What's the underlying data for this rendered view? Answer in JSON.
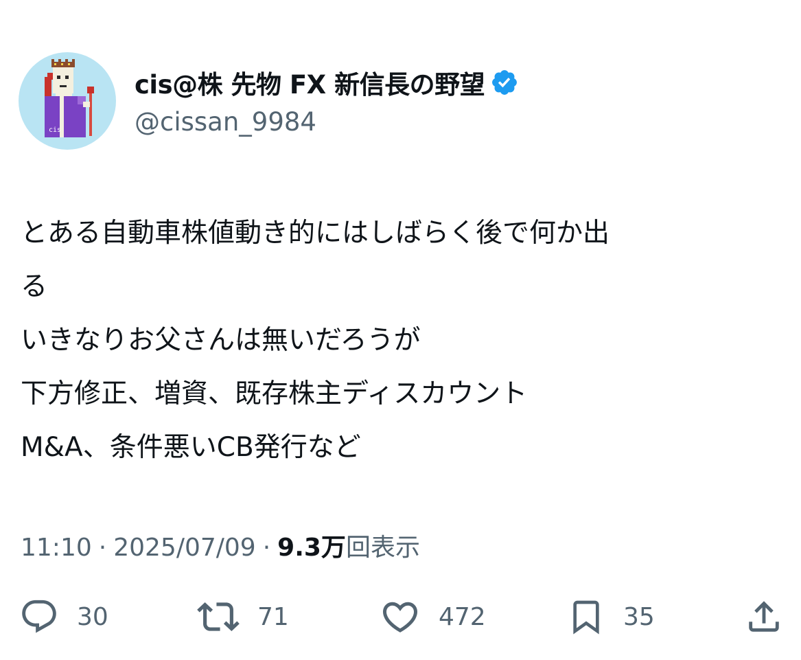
{
  "user": {
    "display_name": "cis@株 先物 FX 新信長の野望",
    "handle": "@cissan_9984",
    "verified": true,
    "avatar_label": "cis"
  },
  "tweet": {
    "lines": [
      "とある自動車株値動き的にはしばらく後で何か出",
      "る",
      "いきなりお父さんは無いだろうが",
      "下方修正、増資、既存株主ディスカウント",
      "M&A、条件悪いCB発行など"
    ]
  },
  "meta": {
    "time": "11:10",
    "separator": "·",
    "date": "2025/07/09",
    "views_count": "9.3万",
    "views_label": "回表示"
  },
  "actions": {
    "reply_count": "30",
    "retweet_count": "71",
    "like_count": "472",
    "bookmark_count": "35"
  },
  "icons": {
    "reply": "speech-bubble-icon",
    "retweet": "retweet-arrows-icon",
    "like": "heart-icon",
    "bookmark": "bookmark-icon",
    "share": "share-upload-icon",
    "verified": "verified-badge-icon"
  },
  "colors": {
    "text_primary": "#0f1419",
    "text_secondary": "#536471",
    "verified_blue": "#1d9bf0",
    "avatar_bg": "#b9e4f3"
  }
}
